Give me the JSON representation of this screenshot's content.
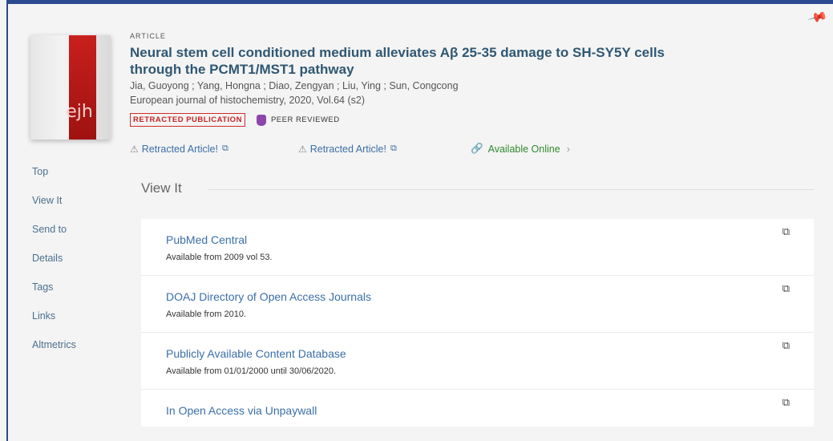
{
  "record": {
    "type": "ARTICLE",
    "title": "Neural stem cell conditioned medium alleviates Aβ 25-35 damage to SH-SY5Y cells through the PCMT1/MST1 pathway",
    "authors": "Jia, Guoyong ; Yang, Hongna ; Diao, Zengyan ; Liu, Ying ; Sun, Congcong",
    "source": "European journal of histochemistry, 2020, Vol.64 (s2)",
    "cover_logo": "ejh",
    "badge_retracted": "RETRACTED PUBLICATION",
    "badge_peer": "PEER REVIEWED"
  },
  "links": {
    "retracted1": "Retracted Article!",
    "retracted2": "Retracted Article!",
    "available": "Available Online"
  },
  "sidenav": [
    "Top",
    "View It",
    "Send to",
    "Details",
    "Tags",
    "Links",
    "Altmetrics"
  ],
  "view_it": {
    "title": "View It",
    "rows": [
      {
        "name": "PubMed Central",
        "coverage": "Available from 2009 vol 53."
      },
      {
        "name": "DOAJ Directory of Open Access Journals",
        "coverage": "Available from 2010."
      },
      {
        "name": "Publicly Available Content Database",
        "coverage": "Available from 01/01/2000 until 30/06/2020."
      },
      {
        "name": "In Open Access via Unpaywall",
        "coverage": ""
      }
    ]
  },
  "icons": {
    "pin": "pin-icon",
    "external": "external-link-icon",
    "warning": "warning-icon",
    "link": "link-icon"
  },
  "colors": {
    "accent_border": "#2b4a8f",
    "link": "#3a6fa8",
    "title": "#2f5873",
    "retracted": "#c72323",
    "available": "#2f8a2f"
  }
}
